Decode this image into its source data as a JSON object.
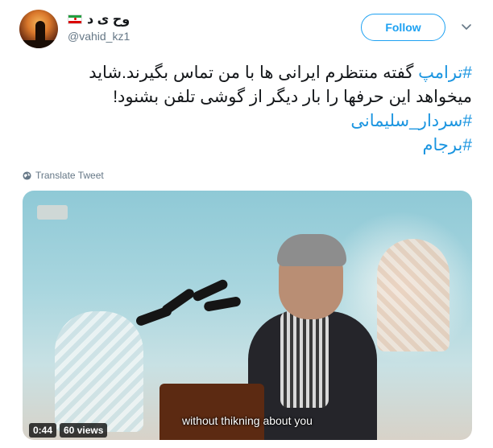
{
  "author": {
    "display_name": "و‌ح ی د",
    "handle": "@vahid_kz1",
    "avatar_icon": "avatar-sunset-silhouette",
    "flag_icon": "iran-flag-icon"
  },
  "follow_button": {
    "label": "Follow"
  },
  "menu": {
    "icon": "chevron-down-icon"
  },
  "tweet": {
    "lines": [
      {
        "hashtag": "#ترامپ",
        "text": " گفته منتظرم ایرانی ها با من تماس بگیرند.شاید"
      },
      {
        "hashtag": "",
        "text": "میخواهد این حرفها را بار دیگر از گوشی تلفن بشنود!"
      },
      {
        "hashtag": "#سردار_سلیمانی",
        "text": ""
      },
      {
        "hashtag": "#برجام",
        "text": ""
      }
    ]
  },
  "translate": {
    "label": "Translate Tweet",
    "icon": "globe-icon"
  },
  "media": {
    "caption": "without thikning about you",
    "duration": "0:44",
    "views": "60 views"
  },
  "colors": {
    "accent": "#1da1f2",
    "hashtag": "#1b95e0",
    "muted": "#657786"
  }
}
